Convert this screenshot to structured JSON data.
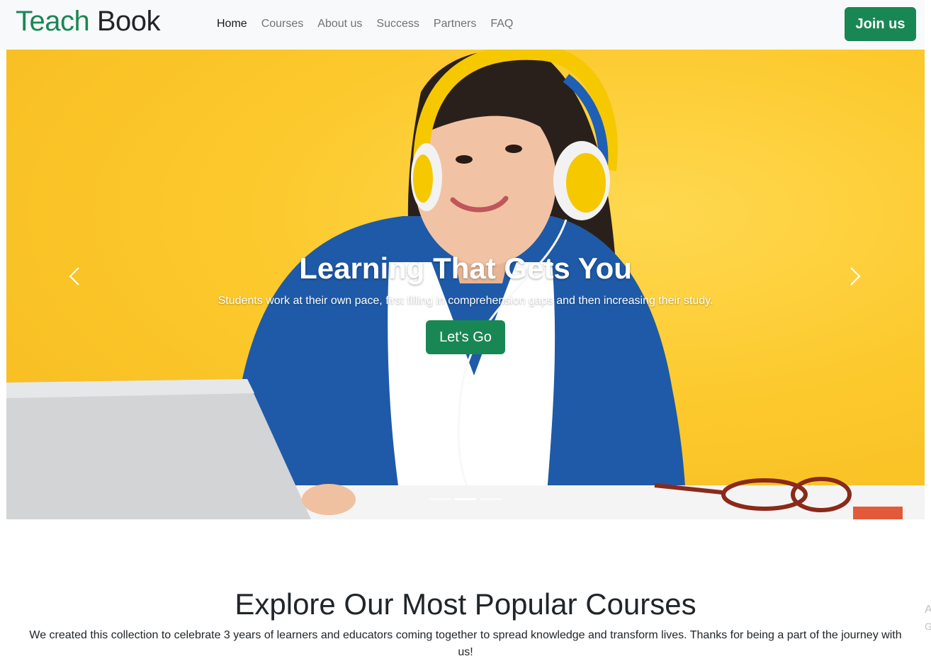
{
  "brand": {
    "part1": "Teach",
    "part2": "Book"
  },
  "nav": {
    "links": [
      "Home",
      "Courses",
      "About us",
      "Success",
      "Partners",
      "FAQ"
    ],
    "active_index": 0,
    "join_label": "Join us"
  },
  "hero": {
    "title": "Learning That Gets You",
    "subtitle": "Students work at their own pace, first filling in comprehension gaps and then increasing their study.",
    "cta_label": "Let's Go",
    "slides_count": 3,
    "active_slide": 1
  },
  "courses": {
    "title": "Explore Our Most Popular Courses",
    "description": "We created this collection to celebrate 3 years of learners and educators coming together to spread knowledge and transform lives. Thanks for being a part of the journey with us!"
  },
  "edge": {
    "letter1": "A",
    "letter2": "G"
  },
  "colors": {
    "brand_green": "#198754",
    "hero_yellow": "#fcc92c",
    "navbar_bg": "#f8f9fa"
  }
}
